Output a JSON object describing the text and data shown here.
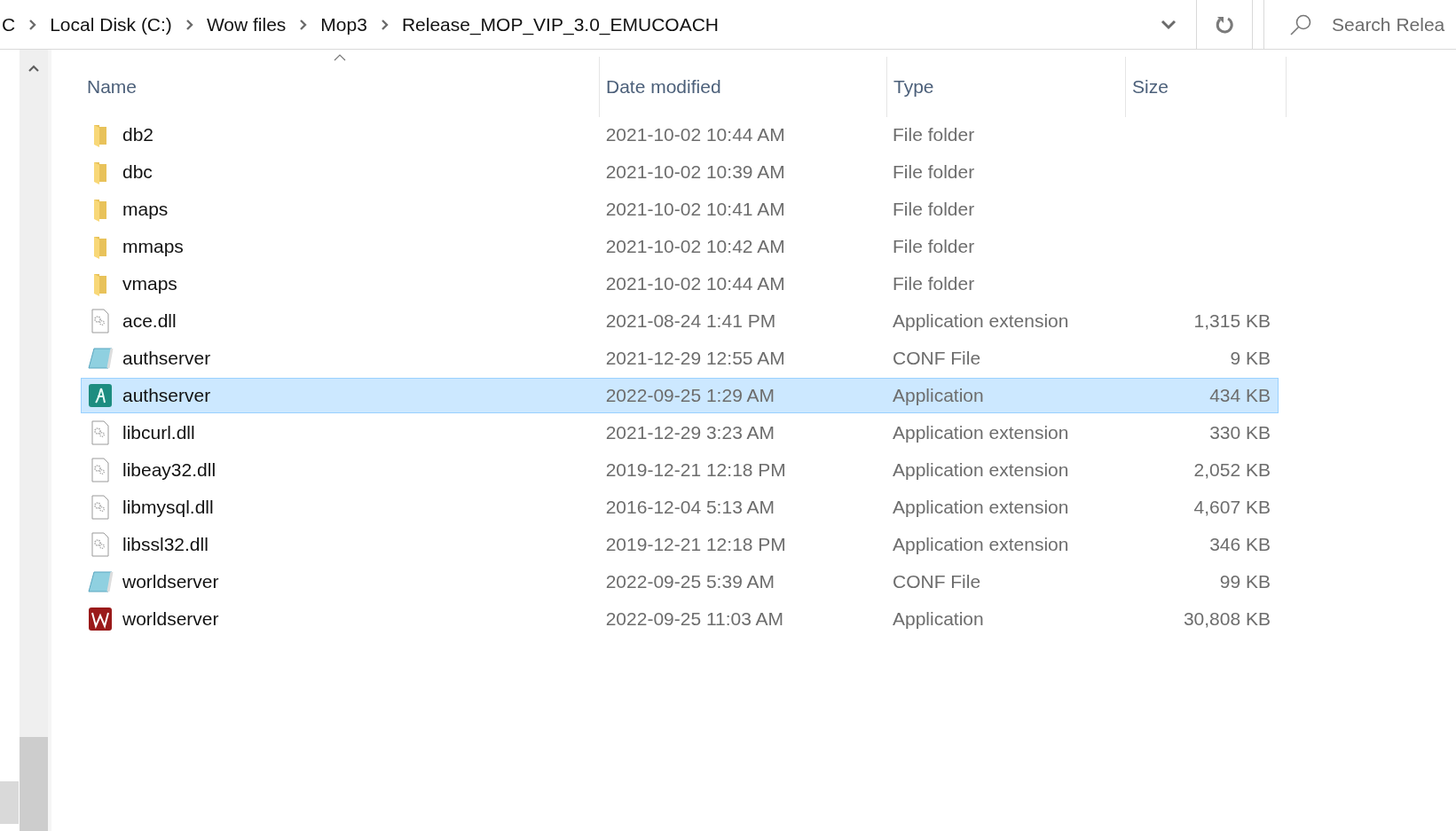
{
  "address_bar": {
    "breadcrumbs": [
      "C",
      "Local Disk (C:)",
      "Wow files",
      "Mop3",
      "Release_MOP_VIP_3.0_EMUCOACH"
    ]
  },
  "search": {
    "placeholder": "Search Relea"
  },
  "table": {
    "columns": [
      "Name",
      "Date modified",
      "Type",
      "Size"
    ],
    "rows": [
      {
        "kind": "folder",
        "name": "db2",
        "date": "2021-10-02 10:44 AM",
        "type": "File folder",
        "selected": false
      },
      {
        "kind": "folder",
        "name": "dbc",
        "date": "2021-10-02 10:39 AM",
        "type": "File folder",
        "selected": false
      },
      {
        "kind": "folder",
        "name": "maps",
        "date": "2021-10-02 10:41 AM",
        "type": "File folder",
        "selected": false
      },
      {
        "kind": "folder",
        "name": "mmaps",
        "date": "2021-10-02 10:42 AM",
        "type": "File folder",
        "selected": false
      },
      {
        "kind": "folder",
        "name": "vmaps",
        "date": "2021-10-02 10:44 AM",
        "type": "File folder",
        "selected": false
      },
      {
        "kind": "dll",
        "name": "ace.dll",
        "date": "2021-08-24 1:41 PM",
        "type": "Application extension",
        "size": "1,315 KB",
        "selected": false
      },
      {
        "kind": "conf",
        "name": "authserver",
        "date": "2021-12-29 12:55 AM",
        "type": "CONF File",
        "size": "9 KB",
        "selected": false
      },
      {
        "kind": "app_a",
        "name": "authserver",
        "date": "2022-09-25 1:29 AM",
        "type": "Application",
        "size": "434 KB",
        "selected": true
      },
      {
        "kind": "dll",
        "name": "libcurl.dll",
        "date": "2021-12-29 3:23 AM",
        "type": "Application extension",
        "size": "330 KB",
        "selected": false
      },
      {
        "kind": "dll",
        "name": "libeay32.dll",
        "date": "2019-12-21 12:18 PM",
        "type": "Application extension",
        "size": "2,052 KB",
        "selected": false
      },
      {
        "kind": "dll",
        "name": "libmysql.dll",
        "date": "2016-12-04 5:13 AM",
        "type": "Application extension",
        "size": "4,607 KB",
        "selected": false
      },
      {
        "kind": "dll",
        "name": "libssl32.dll",
        "date": "2019-12-21 12:18 PM",
        "type": "Application extension",
        "size": "346 KB",
        "selected": false
      },
      {
        "kind": "conf",
        "name": "worldserver",
        "date": "2022-09-25 5:39 AM",
        "type": "CONF File",
        "size": "99 KB",
        "selected": false
      },
      {
        "kind": "app_w",
        "name": "worldserver",
        "date": "2022-09-25 11:03 AM",
        "type": "Application",
        "size": "30,808 KB",
        "selected": false
      }
    ]
  }
}
